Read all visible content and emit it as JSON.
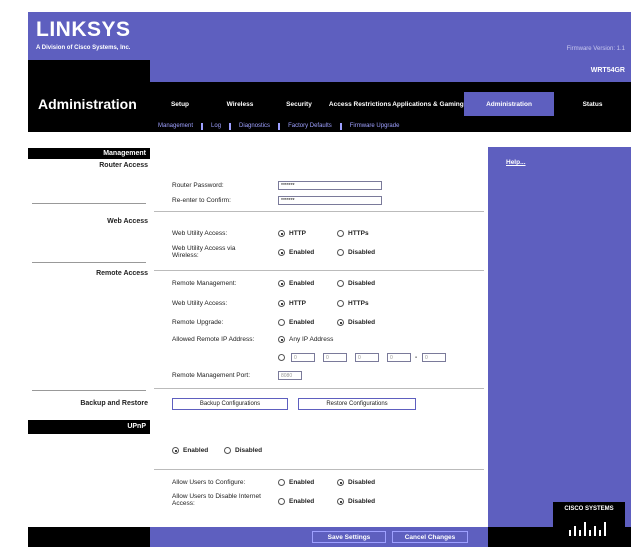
{
  "brand": {
    "logo": "LINKSYS",
    "subtitle": "A Division of Cisco Systems, Inc.",
    "firmware": "Firmware Version: 1.1"
  },
  "header": {
    "title": "Administration",
    "model": "WRT54GR"
  },
  "tabs": [
    {
      "label": "Setup"
    },
    {
      "label": "Wireless"
    },
    {
      "label": "Security"
    },
    {
      "label": "Access Restrictions"
    },
    {
      "label": "Applications & Gaming"
    },
    {
      "label": "Administration"
    },
    {
      "label": "Status"
    }
  ],
  "subtabs": [
    {
      "label": "Management"
    },
    {
      "label": "Log"
    },
    {
      "label": "Diagnostics"
    },
    {
      "label": "Factory Defaults"
    },
    {
      "label": "Firmware Upgrade"
    }
  ],
  "sections": {
    "management": "Management",
    "router_access": "Router Access",
    "web_access": "Web Access",
    "remote_access": "Remote Access",
    "backup": "Backup and Restore",
    "upnp": "UPnP"
  },
  "fields": {
    "router_password": {
      "label": "Router Password:",
      "value": "*******"
    },
    "reenter": {
      "label": "Re-enter to Confirm:",
      "value": "*******"
    },
    "web_utility_access": {
      "label": "Web Utility Access:",
      "opt1": "HTTP",
      "opt2": "HTTPs"
    },
    "web_utility_wireless": {
      "label": "Web Utility Access via Wireless:",
      "opt1": "Enabled",
      "opt2": "Disabled"
    },
    "remote_management": {
      "label": "Remote Management:",
      "opt1": "Enabled",
      "opt2": "Disabled"
    },
    "remote_web_utility": {
      "label": "Web Utility Access:",
      "opt1": "HTTP",
      "opt2": "HTTPs"
    },
    "remote_upgrade": {
      "label": "Remote Upgrade:",
      "opt1": "Enabled",
      "opt2": "Disabled"
    },
    "allowed_ip": {
      "label": "Allowed Remote IP Address:",
      "opt1": "Any IP Address",
      "ip1": "0",
      "ip2": "0",
      "ip3": "0",
      "ip4": "0",
      "ip5": "0",
      "dash": "-"
    },
    "remote_port": {
      "label": "Remote Management Port:",
      "value": "8080"
    },
    "upnp": {
      "opt1": "Enabled",
      "opt2": "Disabled"
    },
    "allow_configure": {
      "label": "Allow Users to Configure:",
      "opt1": "Enabled",
      "opt2": "Disabled"
    },
    "allow_disable": {
      "label": "Allow Users to Disable Internet Access:",
      "opt1": "Enabled",
      "opt2": "Disabled"
    }
  },
  "buttons": {
    "backup": "Backup Configurations",
    "restore": "Restore Configurations",
    "save": "Save Settings",
    "cancel": "Cancel Changes"
  },
  "help": "Help...",
  "cisco": "CISCO SYSTEMS",
  "colors": {
    "brand": "#5e5fbf",
    "nav": "#000000",
    "subtab": "#9ea0ff"
  }
}
